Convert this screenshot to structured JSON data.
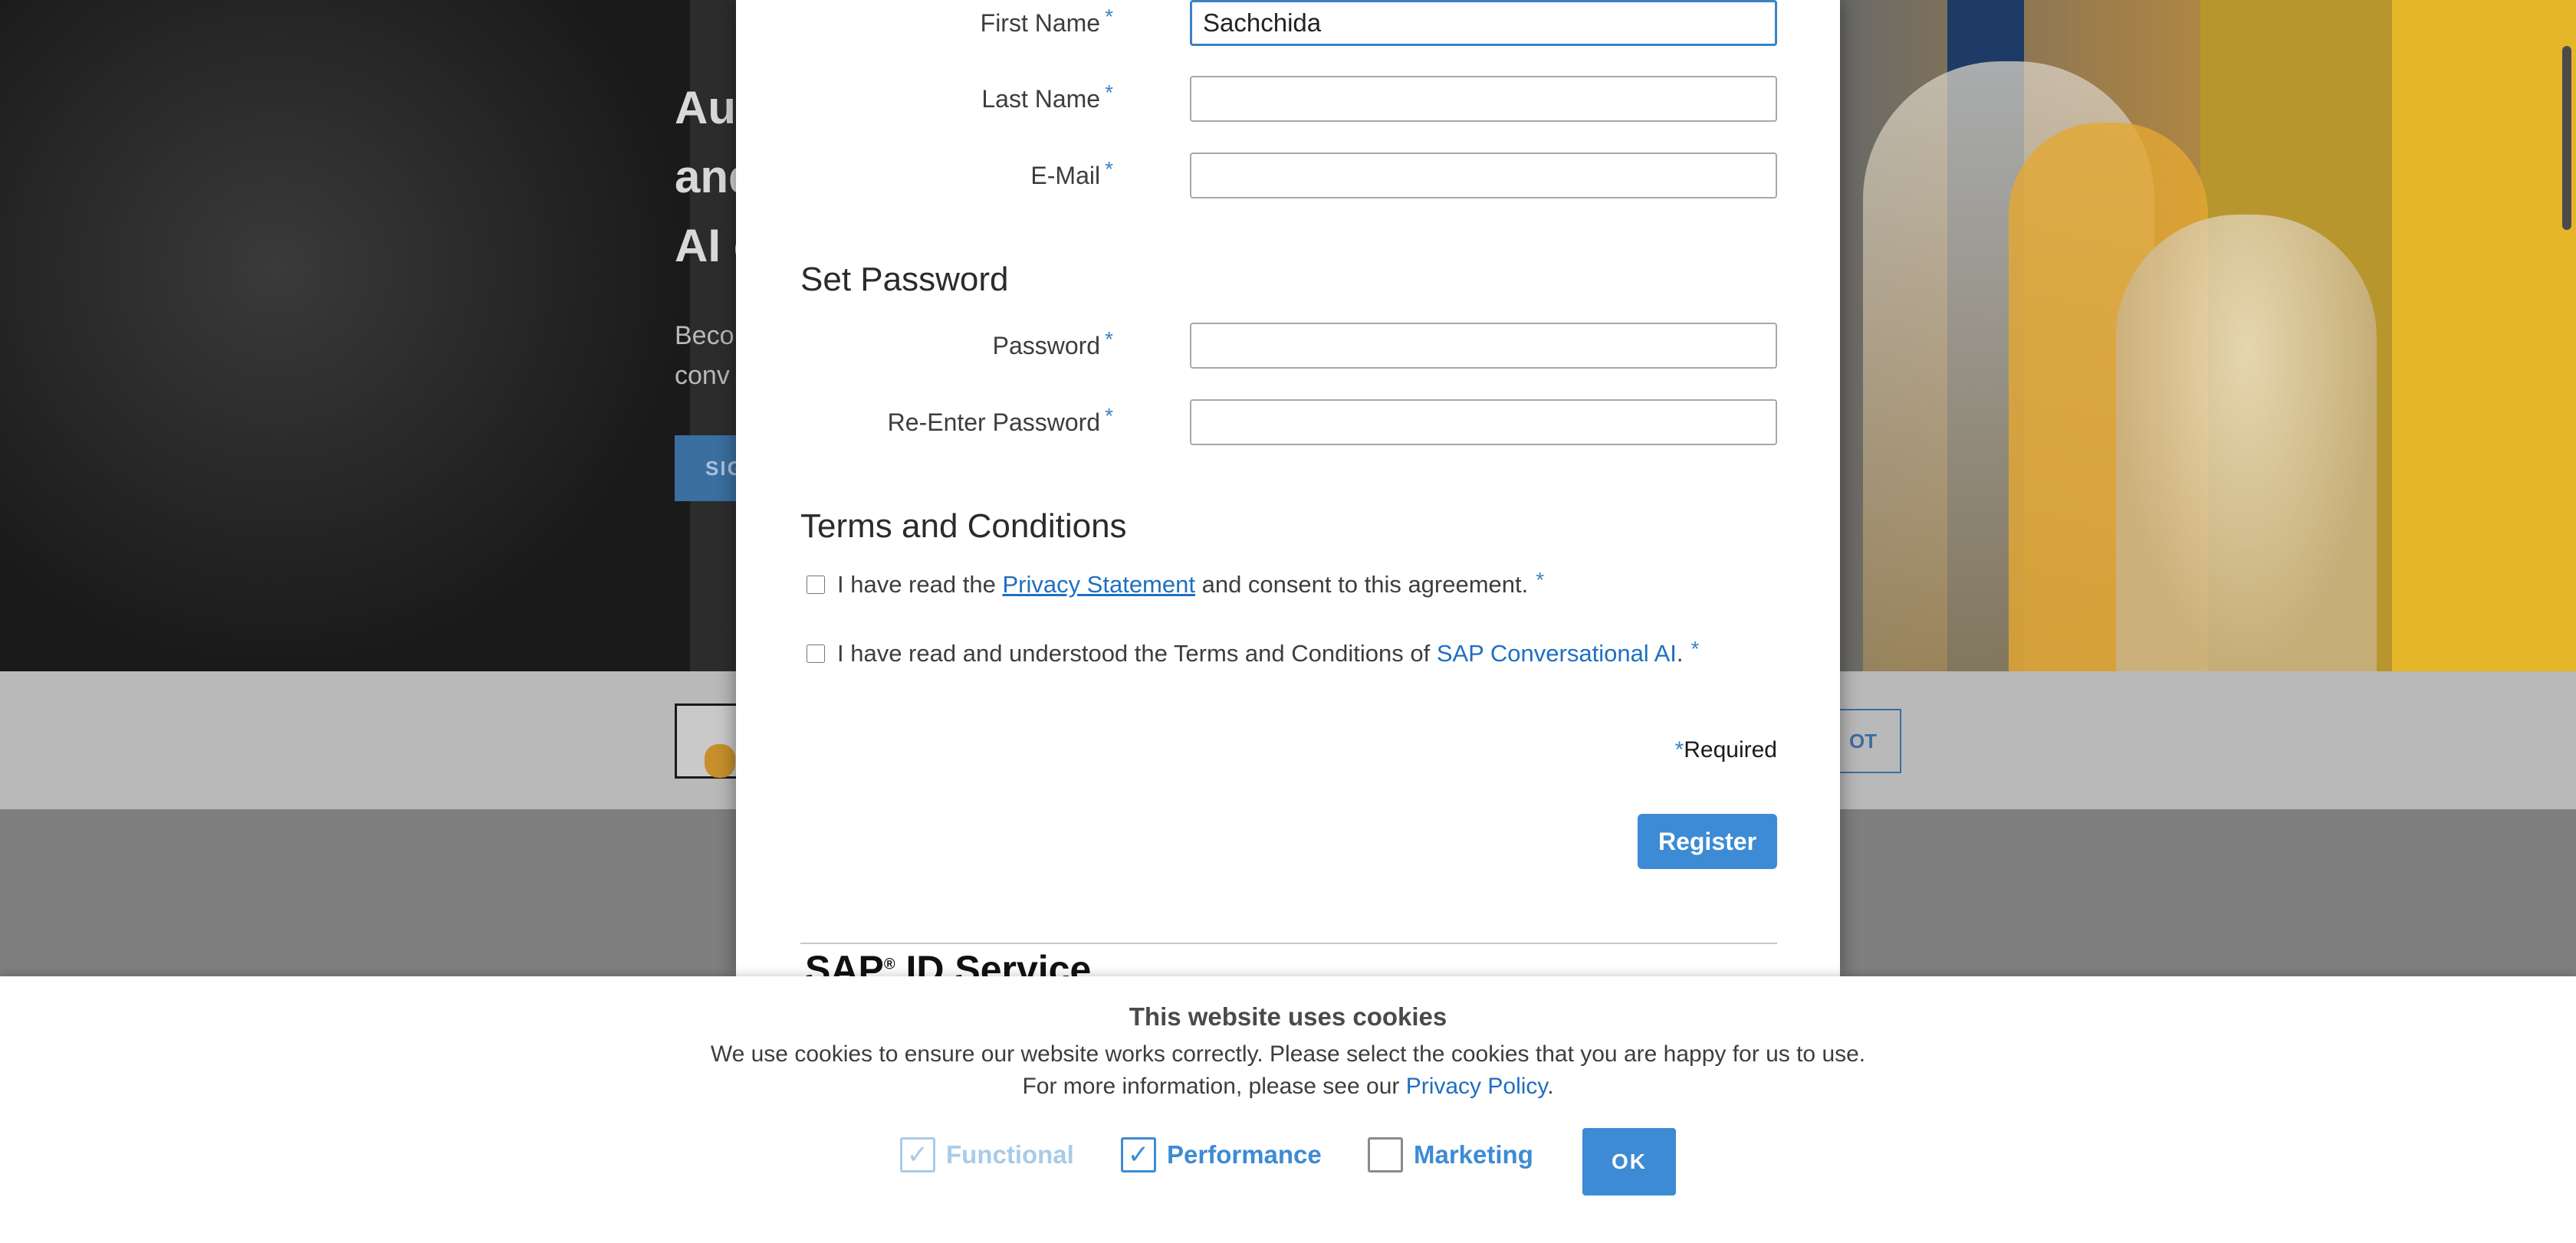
{
  "background": {
    "hero_title_lines": [
      "Au",
      "and",
      "AI c"
    ],
    "hero_sub_lines": [
      "Beco",
      "conv"
    ],
    "hero_button": "SIG",
    "band_button": "OT"
  },
  "form": {
    "first_name": {
      "label": "First Name",
      "required_mark": "*",
      "value": "Sachchida"
    },
    "last_name": {
      "label": "Last Name",
      "required_mark": "*",
      "value": ""
    },
    "email": {
      "label": "E-Mail",
      "required_mark": "*",
      "value": ""
    },
    "set_password_heading": "Set Password",
    "password": {
      "label": "Password",
      "required_mark": "*",
      "value": ""
    },
    "reenter_password": {
      "label": "Re-Enter Password",
      "required_mark": "*",
      "value": ""
    },
    "terms_heading": "Terms and Conditions",
    "privacy_consent": {
      "prefix": "I have read the ",
      "link": "Privacy Statement",
      "suffix": " and consent to this agreement.",
      "required_mark": "*"
    },
    "terms_consent": {
      "prefix": "I have read and understood the Terms and Conditions of ",
      "link": "SAP Conversational AI",
      "suffix": ".",
      "required_mark": "*"
    },
    "required_note_star": "*",
    "required_note": "Required",
    "register_button": "Register",
    "footer_logo": "SAP",
    "footer_logo_mark": "®",
    "footer_logo_suffix": " ID Service"
  },
  "cookie_banner": {
    "title": "This website uses cookies",
    "line1": "We use cookies to ensure our website works correctly. Please select the cookies that you are happy for us to use.",
    "line2_prefix": "For more information, please see our ",
    "line2_link": "Privacy Policy",
    "line2_suffix": ".",
    "options": {
      "functional": {
        "label": "Functional",
        "checked": true,
        "disabled": true,
        "check_glyph": "✓"
      },
      "performance": {
        "label": "Performance",
        "checked": true,
        "check_glyph": "✓"
      },
      "marketing": {
        "label": "Marketing",
        "checked": false,
        "check_glyph": ""
      }
    },
    "ok_button": "OK"
  },
  "colors": {
    "accent": "#3d8bd4",
    "link": "#1f6fc0"
  }
}
